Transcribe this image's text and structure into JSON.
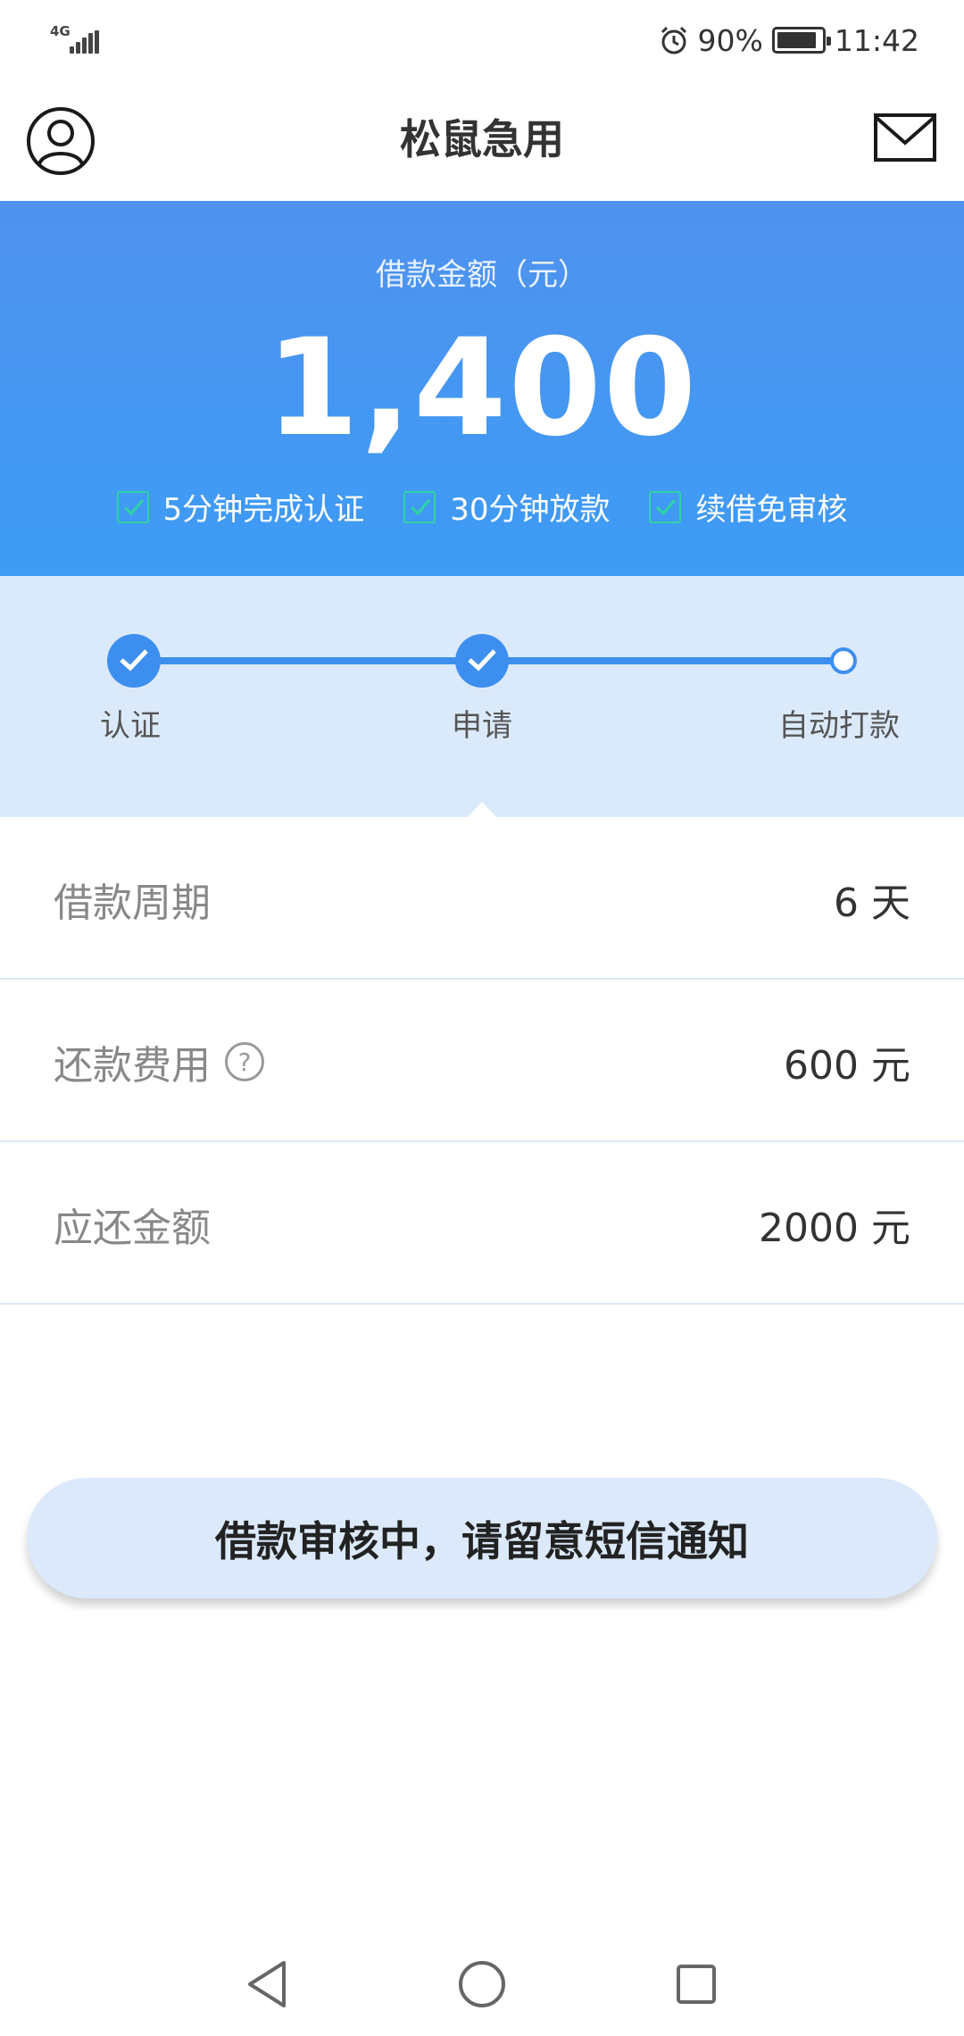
{
  "status_bar": {
    "network": "4G",
    "battery": "90%",
    "time": "11:42"
  },
  "header": {
    "title": "松鼠急用"
  },
  "loan": {
    "amount_label": "借款金额（元）",
    "amount": "1,400",
    "features": [
      {
        "label": "5分钟完成认证"
      },
      {
        "label": "30分钟放款"
      },
      {
        "label": "续借免审核"
      }
    ]
  },
  "progress": {
    "steps": [
      {
        "label": "认证",
        "status": "done"
      },
      {
        "label": "申请",
        "status": "done"
      },
      {
        "label": "自动打款",
        "status": "pending"
      }
    ]
  },
  "details": [
    {
      "label": "借款周期",
      "value": "6 天"
    },
    {
      "label": "还款费用",
      "value": "600 元",
      "help": "?"
    },
    {
      "label": "应还金额",
      "value": "2000 元"
    }
  ],
  "status_button": {
    "label": "借款审核中，请留意短信通知"
  },
  "colors": {
    "brand_blue": "#3d8fef",
    "check_green": "#2fd3a4",
    "stepper_bg": "#dbeafb"
  }
}
